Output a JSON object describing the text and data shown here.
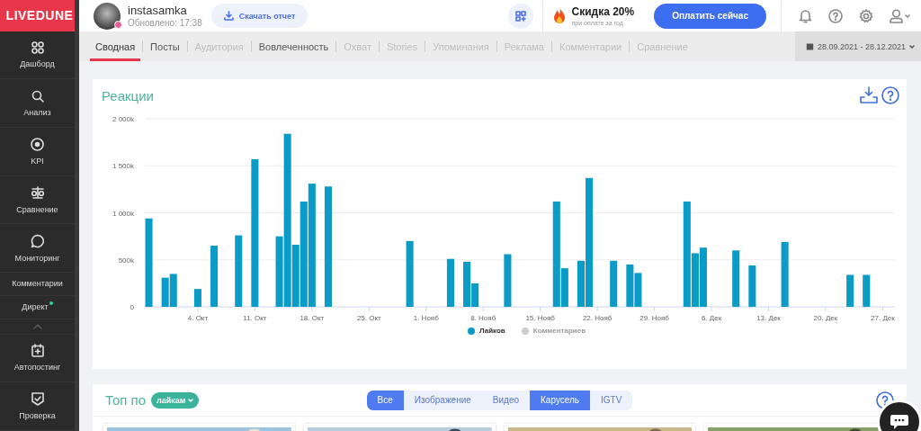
{
  "sidebar": {
    "logo": "LIVEDUNE",
    "items": [
      {
        "label": "Дашборд",
        "kind": "large"
      },
      {
        "label": "Анализ",
        "kind": "large"
      },
      {
        "label": "KPI",
        "kind": "large"
      },
      {
        "label": "Сравнение",
        "kind": "large"
      },
      {
        "label": "Мониторинг",
        "kind": "large"
      },
      {
        "label": "Комментарии",
        "kind": "small",
        "notification": false
      },
      {
        "label": "Директ",
        "kind": "small",
        "notification": true
      },
      {
        "kind": "collapse"
      },
      {
        "label": "Автопостинг",
        "kind": "large"
      },
      {
        "label": "Проверка",
        "kind": "large"
      }
    ]
  },
  "header": {
    "account": {
      "name": "instasamka",
      "updated": "Обновлено: 17:38"
    },
    "download_button": "Скачать отчет",
    "promo": {
      "title": "Скидка 20%",
      "subtitle": "при оплате за год"
    },
    "pay_button": "Оплатить сейчас"
  },
  "tabs": [
    {
      "label": "Сводная",
      "selected": true,
      "disabled": false
    },
    {
      "label": "Посты",
      "selected": false,
      "disabled": false
    },
    {
      "label": "Аудитория",
      "selected": false,
      "disabled": true
    },
    {
      "label": "Вовлеченность",
      "selected": false,
      "disabled": false
    },
    {
      "label": "Охват",
      "selected": false,
      "disabled": true
    },
    {
      "label": "Stories",
      "selected": false,
      "disabled": true
    },
    {
      "label": "Упоминания",
      "selected": false,
      "disabled": true
    },
    {
      "label": "Реклама",
      "selected": false,
      "disabled": true
    },
    {
      "label": "Комментарии",
      "selected": false,
      "disabled": true
    },
    {
      "label": "Сравнение",
      "selected": false,
      "disabled": true
    }
  ],
  "date_range": "28.09.2021 - 28.12.2021",
  "reactions": {
    "title": "Реакции",
    "chart_data": {
      "type": "bar",
      "grid": true,
      "ylim": [
        0,
        2000000
      ],
      "categories": [
        null,
        null,
        null,
        null,
        null,
        null,
        "4. Окт",
        null,
        null,
        null,
        null,
        null,
        null,
        "11. Окт",
        null,
        null,
        null,
        null,
        null,
        null,
        "18. Окт",
        null,
        null,
        null,
        null,
        null,
        null,
        "25. Окт",
        null,
        null,
        null,
        null,
        null,
        null,
        "1. Нояб",
        null,
        null,
        null,
        null,
        null,
        null,
        "8. Нояб",
        null,
        null,
        null,
        null,
        null,
        null,
        "15. Нояб",
        null,
        null,
        null,
        null,
        null,
        null,
        "22. Нояб",
        null,
        null,
        null,
        null,
        null,
        null,
        "29. Нояб",
        null,
        null,
        null,
        null,
        null,
        null,
        "6. Дек",
        null,
        null,
        null,
        null,
        null,
        null,
        "13. Дек",
        null,
        null,
        null,
        null,
        null,
        null,
        "20. Дек",
        null,
        null,
        null,
        null,
        null,
        null,
        "27. Дек",
        null
      ],
      "series": [
        {
          "name": "Лайков",
          "color": "#0a9bc6",
          "values": [
            940000,
            null,
            310000,
            350000,
            null,
            null,
            190000,
            null,
            650000,
            null,
            null,
            760000,
            null,
            1570000,
            null,
            null,
            750000,
            1840000,
            660000,
            1120000,
            1310000,
            null,
            1280000,
            null,
            null,
            null,
            null,
            null,
            null,
            null,
            null,
            null,
            700000,
            null,
            null,
            null,
            null,
            510000,
            null,
            480000,
            250000,
            null,
            null,
            null,
            560000,
            null,
            null,
            null,
            null,
            null,
            1120000,
            410000,
            null,
            490000,
            1370000,
            null,
            null,
            490000,
            null,
            450000,
            360000,
            null,
            null,
            null,
            null,
            null,
            1120000,
            570000,
            630000,
            null,
            null,
            null,
            600000,
            null,
            440000,
            null,
            null,
            null,
            690000,
            null,
            null,
            null,
            null,
            null,
            null,
            null,
            340000,
            null,
            340000,
            null,
            null,
            null
          ]
        }
      ],
      "yticks": [
        {
          "value": 0,
          "label": "0"
        },
        {
          "value": 500000,
          "label": "500k"
        },
        {
          "value": 1000000,
          "label": "1 000k"
        },
        {
          "value": 1500000,
          "label": "1 500k"
        },
        {
          "value": 2000000,
          "label": "2 000k"
        }
      ]
    },
    "legend": [
      {
        "enabled": true
      },
      {
        "label": "Комментариев",
        "color": "#cccccc",
        "enabled": false
      }
    ]
  },
  "top_posts": {
    "title": "Топ по",
    "sort": "лайкам",
    "filters": [
      {
        "label": "Все",
        "selected": true
      },
      {
        "label": "Изображение",
        "selected": false
      },
      {
        "label": "Видео",
        "selected": false
      },
      {
        "label": "Карусель",
        "selected": true
      },
      {
        "label": "IGTV",
        "selected": false
      }
    ]
  }
}
